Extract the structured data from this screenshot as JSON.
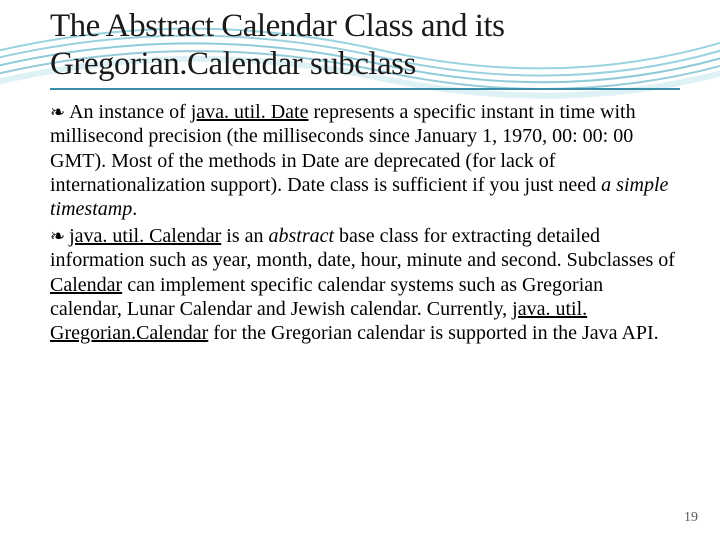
{
  "title": "The Abstract Calendar Class and its Gregorian.Calendar subclass",
  "p1": {
    "a": "An instance of ",
    "u1": "java. util. Date",
    "b": " represents a specific instant in time with millisecond precision (the milliseconds since January 1, 1970, 00: 00: 00 GMT). Most of the methods in Date are deprecated (for lack of internationalization support). Date class is sufficient if you just need ",
    "i1": "a simple timestamp",
    "c": "."
  },
  "p2": {
    "u1": "java. util. Calendar",
    "a": " is an ",
    "i1": "abstract",
    "b": " base class for extracting detailed information such as year, month, date, hour, minute and second. Subclasses of ",
    "u2": "Calendar",
    "c": " can implement specific calendar systems such as Gregorian calendar, Lunar Calendar and Jewish calendar. Currently, ",
    "u3": "java. util. Gregorian.Calendar",
    "d": " for the Gregorian calendar is supported in the Java API."
  },
  "bullet_glyph": "❧",
  "page_number": "19"
}
